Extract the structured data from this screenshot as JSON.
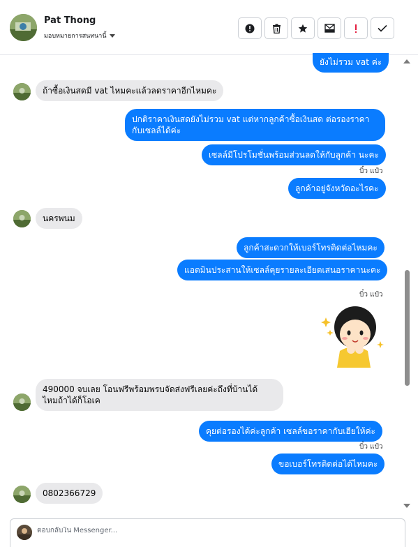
{
  "header": {
    "contact_name": "Pat Thong",
    "assign_label": "มอบหมายการสนทนานี้",
    "actions": [
      {
        "name": "spam-report",
        "icon": "alert-circle-icon"
      },
      {
        "name": "delete",
        "icon": "trash-icon"
      },
      {
        "name": "star",
        "icon": "star-icon"
      },
      {
        "name": "mark-unread",
        "icon": "envelope-icon"
      },
      {
        "name": "follow-up",
        "icon": "exclamation-icon",
        "color": "#e41e3f"
      },
      {
        "name": "done",
        "icon": "check-icon"
      }
    ]
  },
  "messages": {
    "m1": "ยังไม่รวม vat ค่ะ",
    "m2": "ถ้าซื้อเงินสดมี vat ไหมคะแล้วลดราคาอีกไหมคะ",
    "m3_line1": "ปกติราคาเงินสดยังไม่รวม vat  แต่หากลูกค้าซื้อเงินสด ต่อรองราคา",
    "m3_line2": "กับเซลล์ได้ค่ะ",
    "m4": "เซลล์มีโปรโมชั่นพร้อมส่วนลดให้กับลูกค้า นะคะ",
    "seen1": "บิ๋ว แป๋ว",
    "m5": "ลูกค้าอยู่จังหวัดอะไรคะ",
    "m6": "นครพนม",
    "m7": "ลูกค้าสะดวกให้เบอร์โทรติดต่อไหมคะ",
    "m8": "แอดมินประสานให้เซลล์คุยรายละเอียดเสนอราคานะคะ",
    "seen2": "บิ๋ว แป๋ว",
    "m9_line1": "490000  จบเลย  โอนฟรีพร้อมพรบจัดส่งฟรีเลยค่ะถึงที่บ้านได้",
    "m9_line2": "ไหมถ้าได้ก็โอเค",
    "m10": "คุยต่อรองได้ค่ะลูกค้า  เซลล์ขอราคากับเฮียให้ค่ะ",
    "seen3": "บิ๋ว แป๋ว",
    "m11": "ขอเบอร์โทรติดต่อได้ไหมคะ",
    "m12": "0802366729"
  },
  "composer": {
    "placeholder": "ตอบกลับใน Messenger..."
  },
  "colors": {
    "outgoing_bubble": "#0a7cff",
    "incoming_bubble": "#e9e9eb"
  }
}
